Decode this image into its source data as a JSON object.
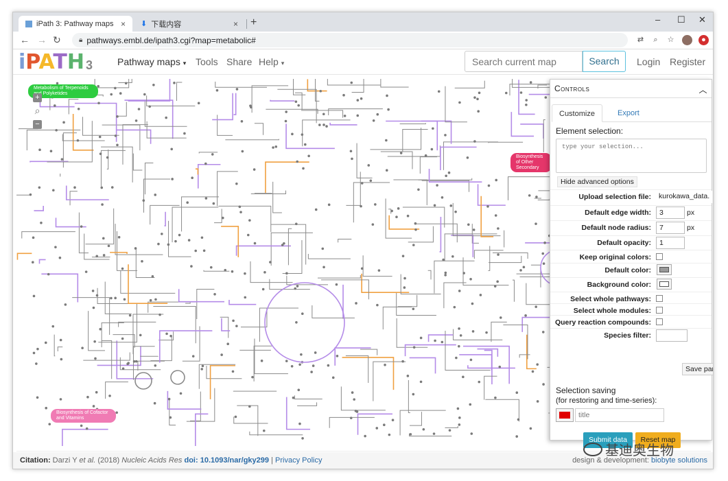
{
  "browser": {
    "tabs": [
      {
        "title": "iPath 3: Pathway maps",
        "close": "×"
      },
      {
        "title": "下载内容",
        "close": "×"
      }
    ],
    "new_tab": "+",
    "url": "pathways.embl.de/ipath3.cgi?map=metabolic#",
    "window_controls": {
      "minimize": "–",
      "maximize": "☐",
      "close": "✕"
    },
    "nav": {
      "back": "←",
      "forward": "→",
      "reload": "↻"
    }
  },
  "app": {
    "logo_text": "iPATH",
    "logo_num": "3",
    "logo_colors": [
      "#7a9cd6",
      "#e1572f",
      "#f5b82a",
      "#9b6bc6",
      "#5bb36d"
    ],
    "nav": {
      "pathway_maps": "Pathway maps",
      "tools": "Tools",
      "share": "Share",
      "help": "Help",
      "login": "Login",
      "register": "Register"
    },
    "search": {
      "placeholder": "Search current map",
      "button": "Search"
    }
  },
  "map": {
    "labels": [
      {
        "text": "Metabolism of Terpenoids and Polyketides",
        "color": "#2ecc40"
      },
      {
        "text": "Biosynthesis of Other Secondary",
        "color": "#e5366a"
      },
      {
        "text": "Biosynthesis of Cofactor and Vitamins",
        "color": "#f07bb4"
      }
    ],
    "zoom": {
      "in": "+",
      "out": "−"
    }
  },
  "controls": {
    "title": "Controls",
    "tabs": {
      "customize": "Customize",
      "export": "Export"
    },
    "element_selection": "Element selection:",
    "selection_placeholder": "type your selection...",
    "hide_advanced": "Hide advanced options",
    "rows": {
      "upload_label": "Upload selection file:",
      "upload_value": "kurokawa_data.",
      "edge_width_label": "Default edge width:",
      "edge_width_value": "3",
      "node_radius_label": "Default node radius:",
      "node_radius_value": "7",
      "unit": "px",
      "opacity_label": "Default opacity:",
      "opacity_value": "1",
      "keep_colors_label": "Keep original colors:",
      "default_color_label": "Default color:",
      "default_color": "#999999",
      "bg_color_label": "Background color:",
      "bg_color": "#ffffff",
      "whole_pathways_label": "Select whole pathways:",
      "whole_modules_label": "Select whole modules:",
      "query_compounds_label": "Query reaction compounds:",
      "species_filter_label": "Species filter:"
    },
    "save_params": "Save par",
    "selection_saving": "Selection saving",
    "selection_saving_sub": "(for restoring and time-series):",
    "title_placeholder": "title",
    "swatch_color": "#e00000",
    "submit": "Submit data",
    "reset": "Reset map",
    "accent_submit": "#2a9fbc",
    "accent_reset": "#f0ad1e"
  },
  "footer": {
    "citation_label": "Citation:",
    "citation_authors": "Darzi Y",
    "citation_etal": "et al.",
    "citation_year": "(2018)",
    "citation_journal": "Nucleic Acids Res",
    "doi_label": "doi:",
    "doi": "10.1093/nar/gky299",
    "privacy": "Privacy Policy",
    "credit_prefix": "design & development:",
    "credit_link": "biobyte solutions"
  },
  "watermark": "基迪奥生物"
}
